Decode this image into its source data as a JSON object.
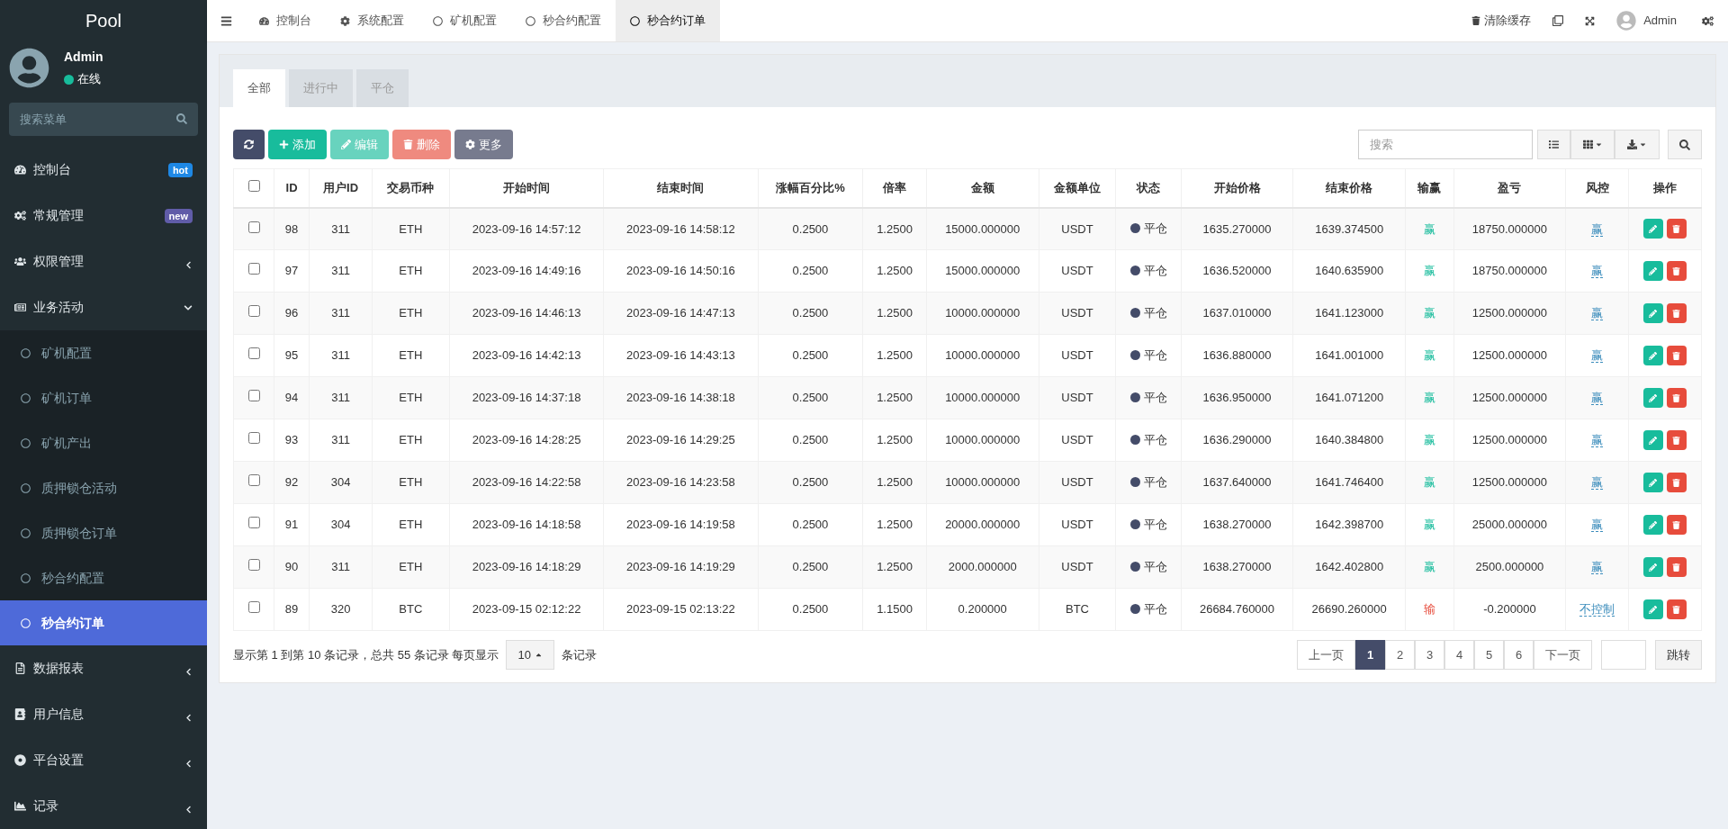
{
  "sidebar": {
    "brand": "Pool",
    "user": {
      "name": "Admin",
      "status": "在线",
      "online": true
    },
    "search_placeholder": "搜索菜单",
    "items": [
      {
        "label": "控制台",
        "badge": "hot",
        "color": "#1e88e5",
        "selected": false
      },
      {
        "label": "常规管理",
        "badge": "new",
        "color": "#605ca8",
        "selected": false
      },
      {
        "label": "权限管理",
        "expanded": false,
        "selected": false
      },
      {
        "label": "业务活动",
        "expanded": true,
        "selected": false,
        "children": [
          {
            "label": "矿机配置",
            "selected": false
          },
          {
            "label": "矿机订单",
            "selected": false
          },
          {
            "label": "矿机产出",
            "selected": false
          },
          {
            "label": "质押锁仓活动",
            "selected": false
          },
          {
            "label": "质押锁仓订单",
            "selected": false
          },
          {
            "label": "秒合约配置",
            "selected": false
          },
          {
            "label": "秒合约订单",
            "selected": true
          }
        ]
      },
      {
        "label": "数据报表",
        "expanded": false,
        "selected": false
      },
      {
        "label": "用户信息",
        "expanded": false,
        "selected": false
      },
      {
        "label": "平台设置",
        "expanded": false,
        "selected": false
      },
      {
        "label": "记录",
        "expanded": false,
        "selected": false
      }
    ]
  },
  "top_tabs": [
    {
      "label": "控制台",
      "selected": false
    },
    {
      "label": "系统配置",
      "selected": false
    },
    {
      "label": "矿机配置",
      "selected": false
    },
    {
      "label": "秒合约配置",
      "selected": false
    },
    {
      "label": "秒合约订单",
      "selected": true
    }
  ],
  "top_right": {
    "clear_cache": "清除缓存",
    "user": "Admin"
  },
  "content_tabs": [
    {
      "label": "全部",
      "selected": true
    },
    {
      "label": "进行中",
      "selected": false
    },
    {
      "label": "平仓",
      "selected": false
    }
  ],
  "toolbar": [
    {
      "kind": "refresh",
      "disabled": false
    },
    {
      "kind": "add",
      "label": "添加",
      "disabled": false
    },
    {
      "kind": "edit",
      "label": "编辑",
      "disabled": true
    },
    {
      "kind": "delete",
      "label": "删除",
      "disabled": true
    },
    {
      "kind": "more",
      "label": "更多",
      "disabled": false
    }
  ],
  "search": {
    "placeholder": "搜索"
  },
  "table": {
    "select_all_checked": false,
    "columns": [
      "ID",
      "用户ID",
      "交易币种",
      "开始时间",
      "结束时间",
      "涨幅百分比%",
      "倍率",
      "金额",
      "金额单位",
      "状态",
      "开始价格",
      "结束价格",
      "输赢",
      "盈亏",
      "风控",
      "操作"
    ],
    "rows": [
      {
        "checked": false,
        "cells": [
          "98",
          "311",
          "ETH",
          "2023-09-16 14:57:12",
          "2023-09-16 14:58:12",
          "0.2500",
          "1.2500",
          "15000.000000",
          "USDT"
        ],
        "status": "平仓",
        "start_price": "1635.270000",
        "end_price": "1639.374500",
        "result": {
          "kind": "win",
          "text": "赢"
        },
        "profit": "18750.000000",
        "risk": "赢"
      },
      {
        "checked": false,
        "cells": [
          "97",
          "311",
          "ETH",
          "2023-09-16 14:49:16",
          "2023-09-16 14:50:16",
          "0.2500",
          "1.2500",
          "15000.000000",
          "USDT"
        ],
        "status": "平仓",
        "start_price": "1636.520000",
        "end_price": "1640.635900",
        "result": {
          "kind": "win",
          "text": "赢"
        },
        "profit": "18750.000000",
        "risk": "赢"
      },
      {
        "checked": false,
        "cells": [
          "96",
          "311",
          "ETH",
          "2023-09-16 14:46:13",
          "2023-09-16 14:47:13",
          "0.2500",
          "1.2500",
          "10000.000000",
          "USDT"
        ],
        "status": "平仓",
        "start_price": "1637.010000",
        "end_price": "1641.123000",
        "result": {
          "kind": "win",
          "text": "赢"
        },
        "profit": "12500.000000",
        "risk": "赢"
      },
      {
        "checked": false,
        "cells": [
          "95",
          "311",
          "ETH",
          "2023-09-16 14:42:13",
          "2023-09-16 14:43:13",
          "0.2500",
          "1.2500",
          "10000.000000",
          "USDT"
        ],
        "status": "平仓",
        "start_price": "1636.880000",
        "end_price": "1641.001000",
        "result": {
          "kind": "win",
          "text": "赢"
        },
        "profit": "12500.000000",
        "risk": "赢"
      },
      {
        "checked": false,
        "cells": [
          "94",
          "311",
          "ETH",
          "2023-09-16 14:37:18",
          "2023-09-16 14:38:18",
          "0.2500",
          "1.2500",
          "10000.000000",
          "USDT"
        ],
        "status": "平仓",
        "start_price": "1636.950000",
        "end_price": "1641.071200",
        "result": {
          "kind": "win",
          "text": "赢"
        },
        "profit": "12500.000000",
        "risk": "赢"
      },
      {
        "checked": false,
        "cells": [
          "93",
          "311",
          "ETH",
          "2023-09-16 14:28:25",
          "2023-09-16 14:29:25",
          "0.2500",
          "1.2500",
          "10000.000000",
          "USDT"
        ],
        "status": "平仓",
        "start_price": "1636.290000",
        "end_price": "1640.384800",
        "result": {
          "kind": "win",
          "text": "赢"
        },
        "profit": "12500.000000",
        "risk": "赢"
      },
      {
        "checked": false,
        "cells": [
          "92",
          "304",
          "ETH",
          "2023-09-16 14:22:58",
          "2023-09-16 14:23:58",
          "0.2500",
          "1.2500",
          "10000.000000",
          "USDT"
        ],
        "status": "平仓",
        "start_price": "1637.640000",
        "end_price": "1641.746400",
        "result": {
          "kind": "win",
          "text": "赢"
        },
        "profit": "12500.000000",
        "risk": "赢"
      },
      {
        "checked": false,
        "cells": [
          "91",
          "304",
          "ETH",
          "2023-09-16 14:18:58",
          "2023-09-16 14:19:58",
          "0.2500",
          "1.2500",
          "20000.000000",
          "USDT"
        ],
        "status": "平仓",
        "start_price": "1638.270000",
        "end_price": "1642.398700",
        "result": {
          "kind": "win",
          "text": "赢"
        },
        "profit": "25000.000000",
        "risk": "赢"
      },
      {
        "checked": false,
        "cells": [
          "90",
          "311",
          "ETH",
          "2023-09-16 14:18:29",
          "2023-09-16 14:19:29",
          "0.2500",
          "1.2500",
          "2000.000000",
          "USDT"
        ],
        "status": "平仓",
        "start_price": "1638.270000",
        "end_price": "1642.402800",
        "result": {
          "kind": "win",
          "text": "赢"
        },
        "profit": "2500.000000",
        "risk": "赢"
      },
      {
        "checked": false,
        "cells": [
          "89",
          "320",
          "BTC",
          "2023-09-15 02:12:22",
          "2023-09-15 02:13:22",
          "0.2500",
          "1.1500",
          "0.200000",
          "BTC"
        ],
        "status": "平仓",
        "start_price": "26684.760000",
        "end_price": "26690.260000",
        "result": {
          "kind": "lose",
          "text": "输"
        },
        "profit": "-0.200000",
        "risk": "不控制"
      }
    ]
  },
  "footer": {
    "summary": "显示第 1 到第 10 条记录，总共 55 条记录 每页显示",
    "page_size": "10",
    "suffix": "条记录"
  },
  "pagination": {
    "prev": "上一页",
    "pages": [
      {
        "label": "1",
        "selected": true
      },
      {
        "label": "2",
        "selected": false
      },
      {
        "label": "3",
        "selected": false
      },
      {
        "label": "4",
        "selected": false
      },
      {
        "label": "5",
        "selected": false
      },
      {
        "label": "6",
        "selected": false
      }
    ],
    "next": "下一页",
    "jump": "跳转"
  }
}
